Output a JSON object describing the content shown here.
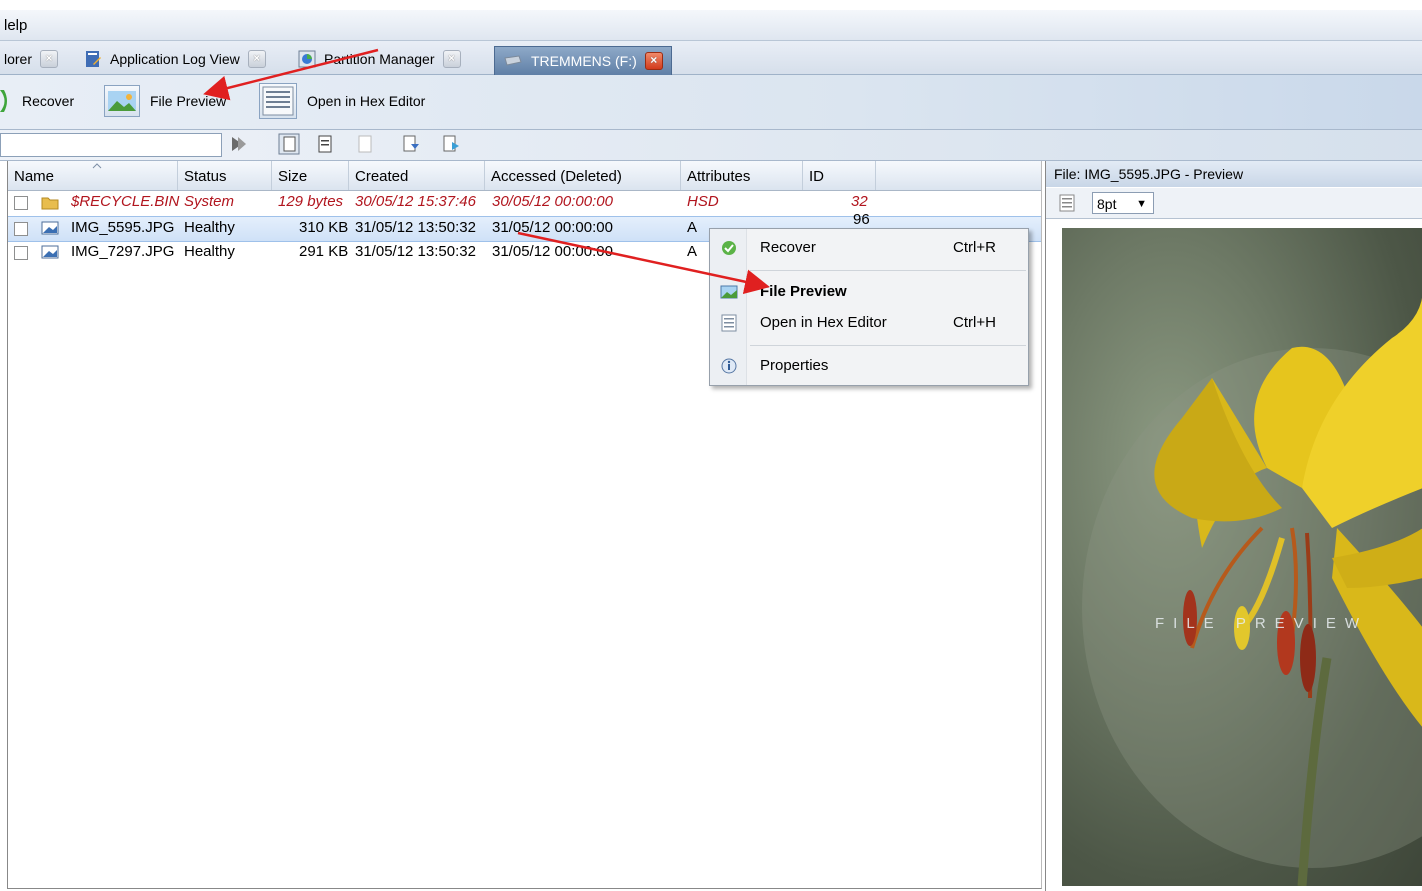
{
  "menu": {
    "help_label": "lelp"
  },
  "tabs": [
    {
      "label": "lorer",
      "active": false
    },
    {
      "label": "Application Log View",
      "active": false
    },
    {
      "label": "Partition Manager",
      "active": false
    },
    {
      "label": "TREMMENS (F:)",
      "active": true
    }
  ],
  "close_glyph": "×",
  "toolbar": {
    "recover_label": "Recover",
    "file_preview_label": "File Preview",
    "hex_editor_label": "Open in Hex Editor"
  },
  "search": {
    "value": ""
  },
  "table": {
    "columns": [
      "Name",
      "Status",
      "Size",
      "Created",
      "Accessed (Deleted)",
      "Attributes",
      "ID"
    ],
    "rows": [
      {
        "name": "$RECYCLE.BIN",
        "status": "System",
        "size": "129 bytes",
        "created": "30/05/12 15:37:46",
        "accessed": "30/05/12 00:00:00",
        "attributes": "HSD",
        "id": "32"
      },
      {
        "name": "IMG_5595.JPG",
        "status": "Healthy",
        "size": "310 KB",
        "created": "31/05/12 13:50:32",
        "accessed": "31/05/12 00:00:00",
        "attributes": "A",
        "id": "96"
      },
      {
        "name": "IMG_7297.JPG",
        "status": "Healthy",
        "size": "291 KB",
        "created": "31/05/12 13:50:32",
        "accessed": "31/05/12 00:00:00",
        "attributes": "A",
        "id": ""
      }
    ]
  },
  "context_menu": {
    "items": [
      {
        "label": "Recover",
        "shortcut": "Ctrl+R",
        "icon": "recover-icon"
      },
      {
        "label": "File Preview",
        "shortcut": "",
        "icon": "image-icon"
      },
      {
        "label": "Open in Hex Editor",
        "shortcut": "Ctrl+H",
        "icon": "hex-icon"
      },
      {
        "label": "Properties",
        "shortcut": "",
        "icon": "info-icon"
      }
    ]
  },
  "preview": {
    "title": "File: IMG_5595.JPG - Preview",
    "font_size": "8pt",
    "watermark": "FILE PREVIEW"
  },
  "colors": {
    "system_row": "#b1151e",
    "arrow": "#e02020",
    "flower": "#e3c21a"
  }
}
